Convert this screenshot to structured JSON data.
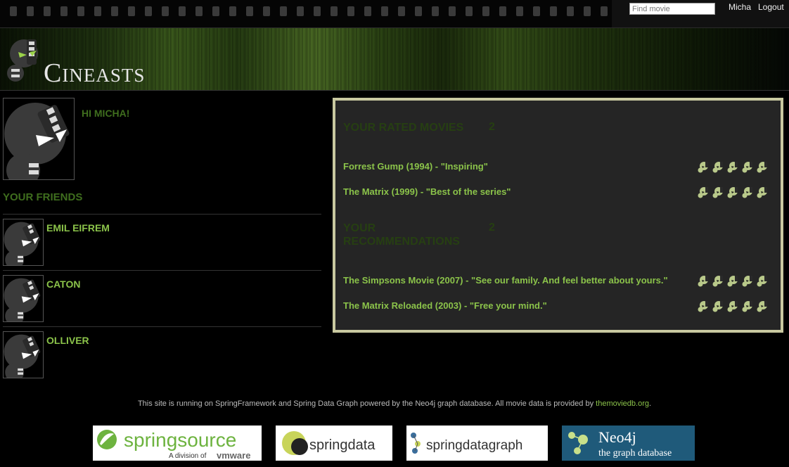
{
  "topbar": {
    "search_placeholder": "Find movie",
    "user_link": "Micha",
    "logout_link": "Logout"
  },
  "header": {
    "title": "Cineasts"
  },
  "profile": {
    "greeting": "HI MICHA!",
    "friends_title": "YOUR FRIENDS",
    "friends": [
      {
        "name": "EMIL EIFREM"
      },
      {
        "name": "CATON"
      },
      {
        "name": "OLLIVER"
      }
    ]
  },
  "rated": {
    "title": "YOUR RATED MOVIES",
    "count": "2",
    "items": [
      {
        "text": "Forrest Gump (1994) - \"Inspiring\"",
        "rating": 5
      },
      {
        "text": "The Matrix (1999) - \"Best of the series\"",
        "rating": 5
      }
    ]
  },
  "recommendations": {
    "title_line1": "YOUR",
    "title_line2": "RECOMMENDATIONS",
    "count": "2",
    "items": [
      {
        "text": "The Simpsons Movie (2007) - \"See our family. And feel better about yours.\"",
        "rating": 5
      },
      {
        "text": "The Matrix Reloaded (2003) - \"Free your mind.\"",
        "rating": 5
      }
    ]
  },
  "footer": {
    "text": "This site is running on SpringFramework and Spring Data Graph powered by the Neo4j graph database. All movie data is provided by",
    "link": "themoviedb.org",
    "after": "."
  },
  "partners": {
    "springsource": "springsource",
    "springsource_sub": "A division of",
    "vmware": "vmware",
    "springdata": "springdata",
    "springdatagraph": "springdatagraph",
    "neo4j": "Neo4j",
    "neo4j_sub": "the graph database"
  },
  "colors": {
    "accent_green": "#8bc34a",
    "title_green": "#3f6e1e",
    "panel_border": "#c9c9a0",
    "panel_bg": "#252525"
  }
}
